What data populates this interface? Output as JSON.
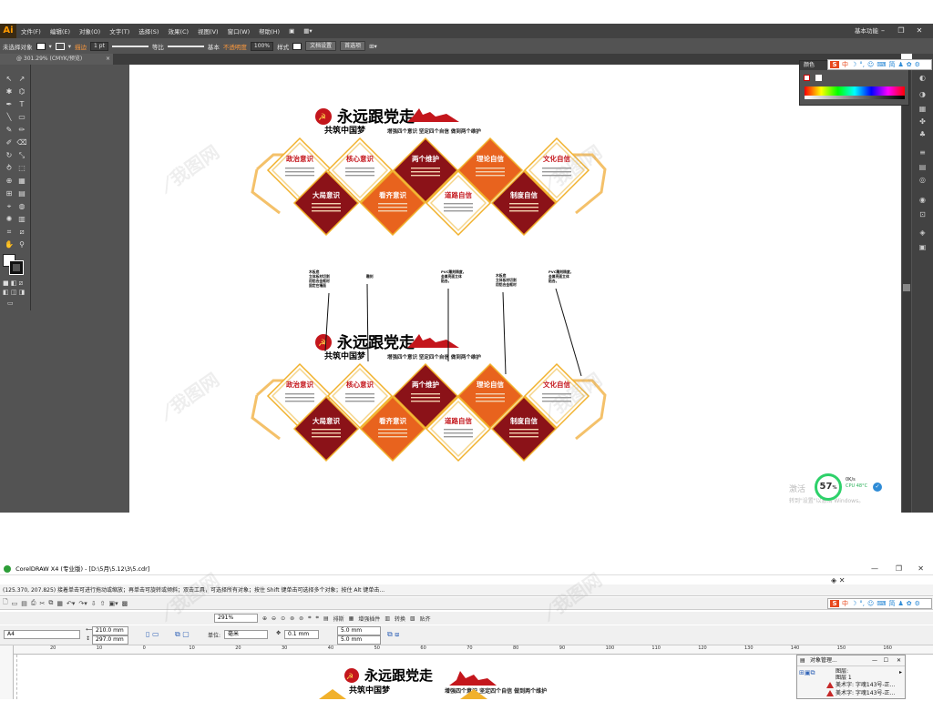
{
  "illustrator": {
    "logo": "Ai",
    "menu": [
      "文件(F)",
      "编辑(E)",
      "对象(O)",
      "文字(T)",
      "选择(S)",
      "效果(C)",
      "视图(V)",
      "窗口(W)",
      "帮助(H)"
    ],
    "workspace": "基本功能",
    "control": {
      "selection": "未选择对象",
      "stroke_label": "描边",
      "stroke_weight": "1 pt",
      "profile": "等比",
      "brush": "基本",
      "opacity_label": "不透明度",
      "opacity_value": "100%",
      "style_label": "样式",
      "doc_setup": "文档设置",
      "prefs": "首选项"
    },
    "doc_tab": "@ 301.29% (CMYK/预览)",
    "color_panel_tab": "颜色"
  },
  "ime": {
    "s": "S",
    "mode": "中",
    "punct": "简"
  },
  "artwork": {
    "title": "永远跟党走",
    "subtitle_red": "共筑中国梦",
    "subtitle_black": "增强四个意识  坚定四个自信  做到两个维护",
    "top_row": [
      "政治意识",
      "核心意识",
      "两个维护",
      "理论自信",
      "文化自信"
    ],
    "bottom_row": [
      "大局意识",
      "看齐意识",
      "道路自信",
      "制度自信"
    ],
    "annotations": [
      "木板底\n立体板材切割\n用铝合金框材\n固定在墙面",
      "雕刻",
      "PVC雕刻精度，\n金属亮面立体\n贴合。",
      "木板底\n立体板材切割\n用铝合金框材",
      "PVC雕刻精度，\n金属亮面立体\n贴合。"
    ]
  },
  "system_widget": {
    "activate": "激活",
    "activate_sub": "转到\"设置\"以激活 Windows。",
    "percent": "57",
    "percent_unit": "%",
    "net": "0K/s",
    "cpu": "CPU 48°C"
  },
  "coreldraw": {
    "title": "CorelDRAW X4 (专业版) - [D:\\5月\\5.12\\3\\5.cdr]",
    "status": "(125.370, 207.825)    接着单击可进行拖动或缩放；再单击可旋转或倾斜；双击工具，可选择所有对象；按住 Shift 键单击可选择多个对象；按住 Alt 键单击...",
    "zoom": "291%",
    "toolbar2": [
      "排斯",
      "增强插件",
      "转换",
      "贴齐"
    ],
    "page_size": "A4",
    "width": "210.0 mm",
    "height": "297.0 mm",
    "units_label": "单位:",
    "units": "毫米",
    "nudge": "0.1 mm",
    "dup_x": "5.0 mm",
    "dup_y": "5.0 mm",
    "ruler": [
      "20",
      "10",
      "0",
      "10",
      "20",
      "30",
      "40",
      "50",
      "60",
      "70",
      "80",
      "90",
      "100",
      "110",
      "120",
      "130",
      "140",
      "150",
      "160"
    ],
    "object_manager": {
      "title": "对象管理...",
      "layer1": "图层:",
      "layer2": "图层 1",
      "rows": [
        "美术字: 字魂143号-正...",
        "美术字: 字魂143号-正..."
      ]
    }
  },
  "colors": {
    "dark_red": "#8b1218",
    "orange": "#e8631e",
    "gold": "#f1b12c",
    "title_red": "#c4161c"
  }
}
